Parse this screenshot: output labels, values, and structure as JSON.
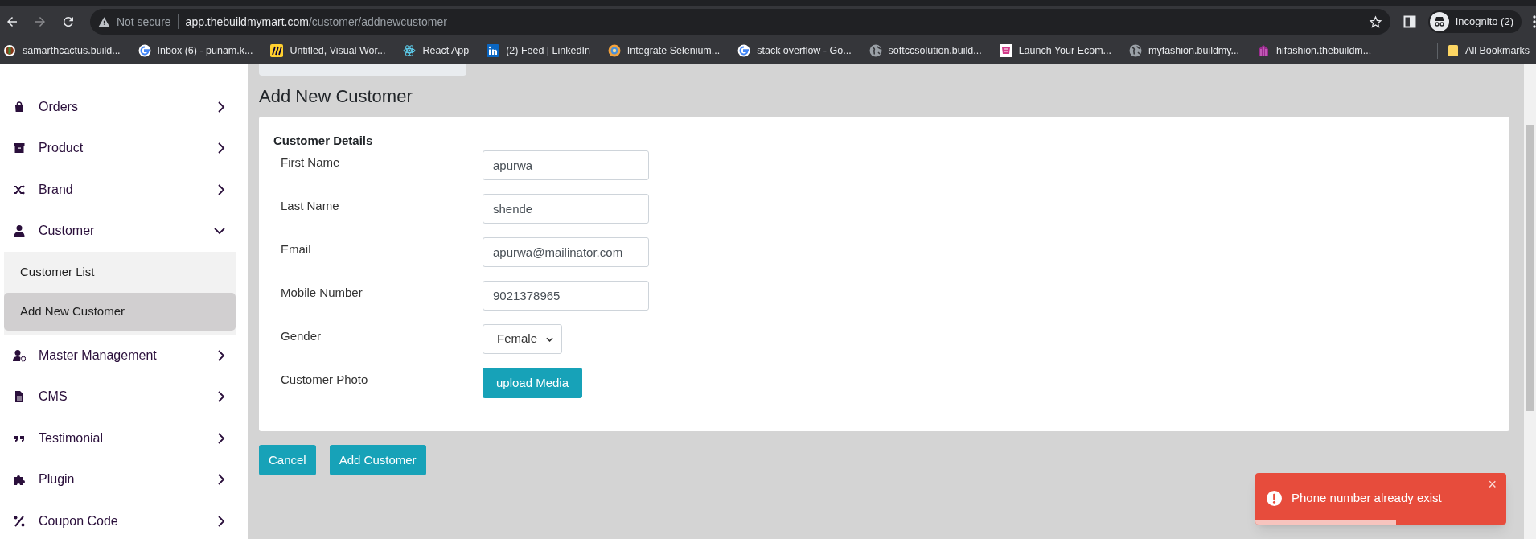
{
  "browser": {
    "security": "Not secure",
    "url_host": "app.thebuildmymart.com",
    "url_path": "/customer/addnewcustomer",
    "profile": "Incognito (2)",
    "bookmarks": [
      {
        "label": "samarthcactus.build...",
        "kind": "site"
      },
      {
        "label": "Inbox (6) - punam.k...",
        "kind": "google"
      },
      {
        "label": "Untitled, Visual Wor...",
        "kind": "miro"
      },
      {
        "label": "React App",
        "kind": "react"
      },
      {
        "label": "(2) Feed | LinkedIn",
        "kind": "linkedin"
      },
      {
        "label": "Integrate Selenium...",
        "kind": "ring"
      },
      {
        "label": "stack overflow - Go...",
        "kind": "google"
      },
      {
        "label": "softccsolution.build...",
        "kind": "globe"
      },
      {
        "label": "Launch Your Ecom...",
        "kind": "shop"
      },
      {
        "label": "myfashion.buildmy...",
        "kind": "globe"
      },
      {
        "label": "hifashion.thebuildm...",
        "kind": "shop2"
      }
    ],
    "all_bookmarks": "All Bookmarks"
  },
  "sidebar": {
    "items": [
      {
        "label": "Orders",
        "kind": "bag",
        "expanded": false
      },
      {
        "label": "Product",
        "kind": "archive",
        "expanded": false
      },
      {
        "label": "Brand",
        "kind": "shuffle",
        "expanded": false
      },
      {
        "label": "Customer",
        "kind": "user",
        "expanded": true,
        "children": [
          {
            "label": "Customer List",
            "selected": false
          },
          {
            "label": "Add New Customer",
            "selected": true
          }
        ]
      },
      {
        "label": "Master Management",
        "kind": "usergear",
        "expanded": false
      },
      {
        "label": "CMS",
        "kind": "file",
        "expanded": false
      },
      {
        "label": "Testimonial",
        "kind": "quote",
        "expanded": false
      },
      {
        "label": "Plugin",
        "kind": "puzzle",
        "expanded": false
      },
      {
        "label": "Coupon Code",
        "kind": "percent",
        "expanded": false
      }
    ]
  },
  "page": {
    "title": "Add New Customer",
    "section": "Customer Details",
    "fields": [
      {
        "label": "First Name",
        "kind": "text",
        "value": "apurwa"
      },
      {
        "label": "Last Name",
        "kind": "text",
        "value": "shende"
      },
      {
        "label": "Email",
        "kind": "text",
        "value": "apurwa@mailinator.com"
      },
      {
        "label": "Mobile Number",
        "kind": "text",
        "value": "9021378965"
      },
      {
        "label": "Gender",
        "kind": "select",
        "value": "Female"
      },
      {
        "label": "Customer Photo",
        "kind": "upload",
        "value": "upload Media"
      }
    ],
    "buttons": [
      "Cancel",
      "Add Customer"
    ]
  },
  "toast": {
    "message": "Phone number already exist",
    "close": "×",
    "level": 0.56
  }
}
